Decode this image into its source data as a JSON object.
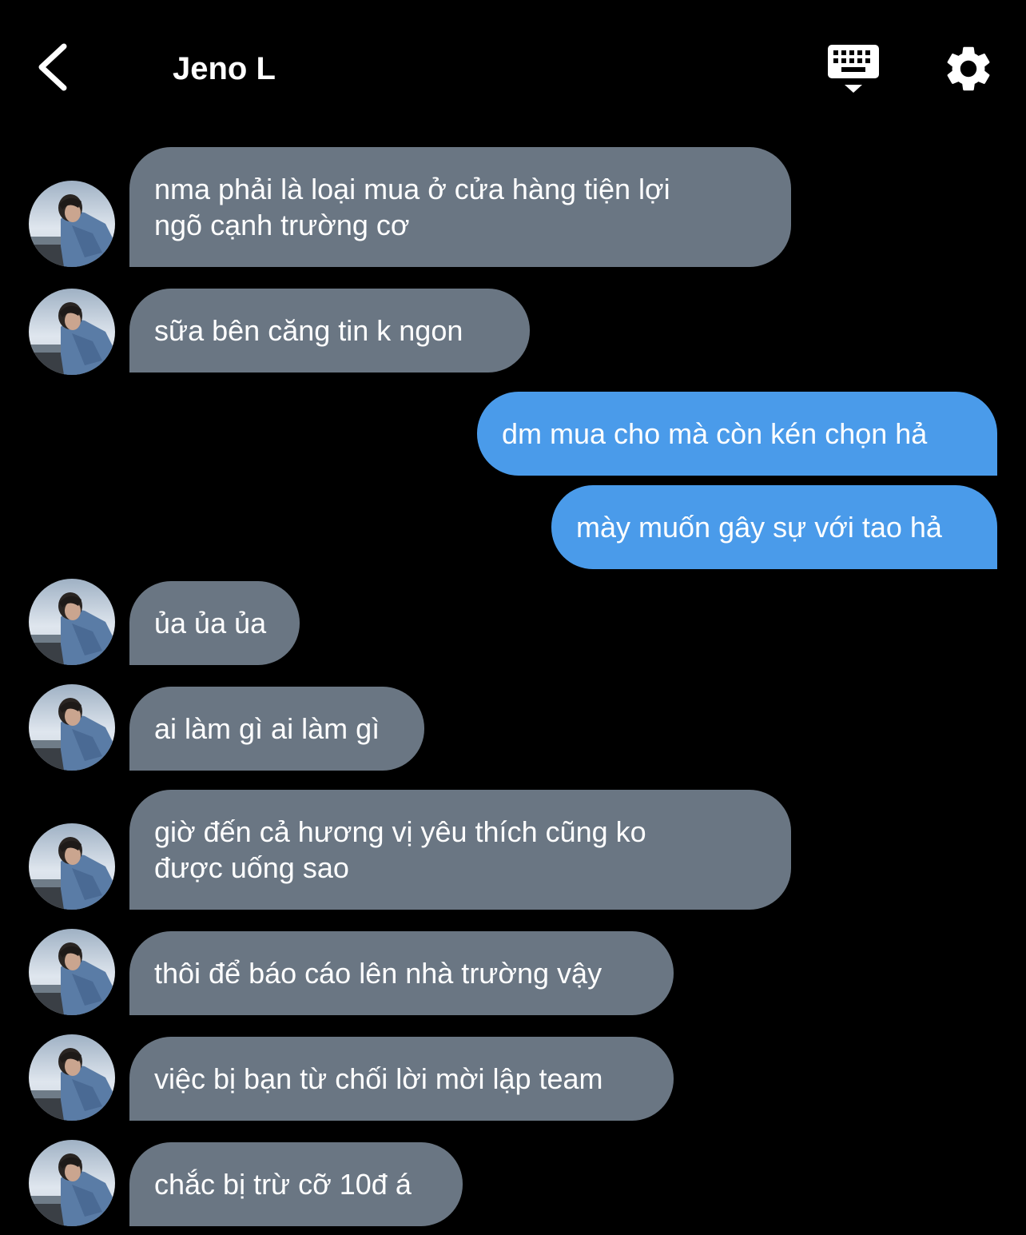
{
  "header": {
    "title": "Jeno L"
  },
  "icons": {
    "back": "chevron-left-icon",
    "keyboard": "keyboard-hide-icon",
    "settings": "gear-icon"
  },
  "colors": {
    "background": "#000000",
    "received_bubble": "#6a7683",
    "sent_bubble": "#4a9bea",
    "text": "#ffffff"
  },
  "messages": [
    {
      "sender": "contact",
      "text": "nma phải là loại mua ở cửa hàng tiện lợi\nngõ cạnh trường cơ"
    },
    {
      "sender": "contact",
      "text": "sữa bên căng tin k ngon"
    },
    {
      "sender": "me",
      "text": "dm mua cho mà còn kén chọn hả"
    },
    {
      "sender": "me",
      "text": "mày muốn gây sự với tao hả"
    },
    {
      "sender": "contact",
      "text": "ủa ủa ủa"
    },
    {
      "sender": "contact",
      "text": "ai làm gì ai làm gì"
    },
    {
      "sender": "contact",
      "text": "giờ đến cả hương vị yêu thích cũng ko\nđược uống sao"
    },
    {
      "sender": "contact",
      "text": "thôi để báo cáo lên nhà trường vậy"
    },
    {
      "sender": "contact",
      "text": "việc bị bạn từ chối lời mời lập team"
    },
    {
      "sender": "contact",
      "text": "chắc bị trừ cỡ 10đ á"
    }
  ]
}
